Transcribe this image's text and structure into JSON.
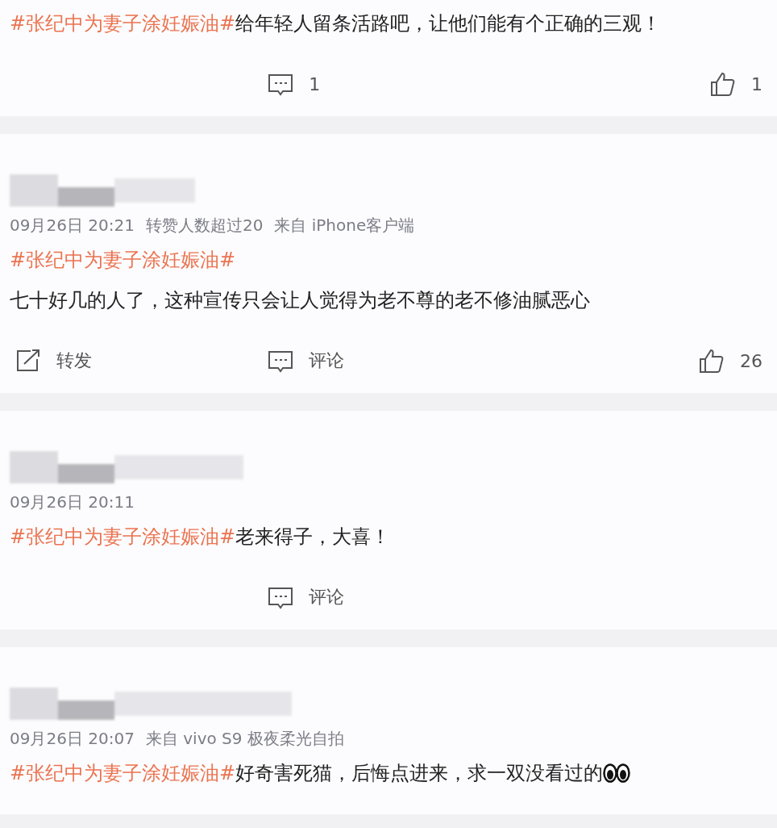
{
  "comments": [
    {
      "author_redacted": false,
      "lines": [
        [
          {
            "kind": "hashtag",
            "text": "#张纪中为妻子涂妊娠油#"
          },
          {
            "kind": "text",
            "text": "给年轻人留条活路吧，让他们能有个正确的三观！"
          }
        ]
      ],
      "actions": [
        {
          "kind": "comment",
          "label": "1"
        },
        {
          "kind": "like",
          "label": "1"
        }
      ]
    },
    {
      "author_redacted": true,
      "meta": [
        "09月26日 20:21",
        "转赞人数超过20",
        "来自 iPhone客户端"
      ],
      "lines": [
        [
          {
            "kind": "hashtag",
            "text": "#张纪中为妻子涂妊娠油#"
          }
        ],
        [
          {
            "kind": "text",
            "text": "七十好几的人了，这种宣传只会让人觉得为老不尊的老不修油腻恶心"
          }
        ]
      ],
      "actions": [
        {
          "kind": "repost",
          "label": "转发"
        },
        {
          "kind": "comment",
          "label": "评论"
        },
        {
          "kind": "like",
          "label": "26"
        }
      ]
    },
    {
      "author_redacted": true,
      "meta": [
        "09月26日 20:11"
      ],
      "lines": [
        [
          {
            "kind": "hashtag",
            "text": "#张纪中为妻子涂妊娠油#"
          },
          {
            "kind": "text",
            "text": "老来得子，大喜！"
          }
        ]
      ],
      "actions": [
        {
          "kind": "comment",
          "label": "评论"
        }
      ]
    },
    {
      "author_redacted": true,
      "meta": [
        "09月26日 20:07",
        "来自 vivo S9 极夜柔光自拍"
      ],
      "lines": [
        [
          {
            "kind": "hashtag",
            "text": "#张纪中为妻子涂妊娠油#"
          },
          {
            "kind": "text",
            "text": "好奇害死猫，后悔点进来，求一双没看过的"
          },
          {
            "kind": "eyes"
          }
        ]
      ]
    }
  ]
}
